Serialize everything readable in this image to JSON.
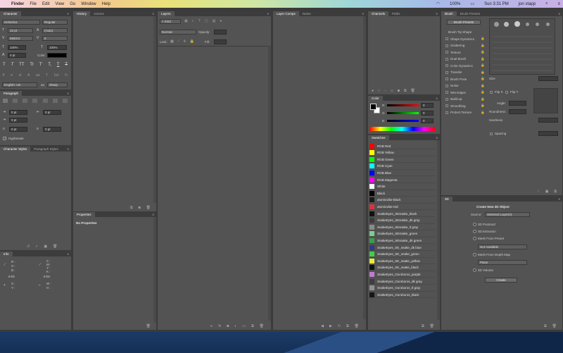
{
  "menubar": {
    "apple": "",
    "app": "Finder",
    "items": [
      "File",
      "Edit",
      "View",
      "Go",
      "Window",
      "Help"
    ],
    "battery": "100%",
    "clock": "Sun 3:31 PM",
    "user": "jon stapp"
  },
  "character": {
    "tab": "Character",
    "font_family": "Helvetica",
    "font_style": "Regular",
    "size": "12 pt",
    "leading": "(Auto)",
    "kerning": "Metrics",
    "tracking": "0",
    "vscale": "100%",
    "hscale": "100%",
    "baseline": "0 pt",
    "color_label": "Color:",
    "language": "English: UK",
    "aa": "Sharp",
    "aa_label": "aa"
  },
  "paragraph": {
    "tab": "Paragraph",
    "indent_left": "0 pt",
    "indent_right": "0 pt",
    "first_line": "0 pt",
    "space_before": "0 pt",
    "space_after": "0 pt",
    "hyphenate": "Hyphenate"
  },
  "styles": {
    "tabs": [
      "Character Styles",
      "Paragraph Styles"
    ]
  },
  "info": {
    "tab": "Info",
    "rgb": [
      "R :",
      "G :",
      "B :"
    ],
    "cmyk": [
      "C :",
      "M :",
      "Y :",
      "K :"
    ],
    "bit1": "8-bit",
    "bit2": "8-bit",
    "x": "X :",
    "y": "Y :",
    "w": "W :",
    "h": "H :"
  },
  "history": {
    "tabs": [
      "History",
      "Actions"
    ]
  },
  "properties": {
    "tab": "Properties",
    "empty": "No Properties"
  },
  "layers": {
    "tab": "Layers",
    "kind": "Kind",
    "blend": "Normal",
    "opacity_label": "Opacity:",
    "lock_label": "Lock:",
    "fill_label": "Fill:"
  },
  "layercomps": {
    "tabs": [
      "Layer Comps",
      "Notes"
    ]
  },
  "channels": {
    "tabs": [
      "Channels",
      "Paths"
    ]
  },
  "color": {
    "tab": "Color",
    "r": "R",
    "g": "G",
    "b": "B",
    "rv": "0",
    "gv": "0",
    "bv": "0"
  },
  "swatches": {
    "tab": "Swatches",
    "items": [
      {
        "name": "RGB Red",
        "color": "#ff0000"
      },
      {
        "name": "RGB Yellow",
        "color": "#ffff00"
      },
      {
        "name": "RGB Green",
        "color": "#00ff00"
      },
      {
        "name": "RGB Cyan",
        "color": "#00ffff"
      },
      {
        "name": "RGB Blue",
        "color": "#0000ff"
      },
      {
        "name": "RGB Magenta",
        "color": "#ff00ff"
      },
      {
        "name": "White",
        "color": "#ffffff"
      },
      {
        "name": "Black",
        "color": "#000000"
      },
      {
        "name": "atomicvibe-black",
        "color": "#1a1a1a"
      },
      {
        "name": "atomicvibe-red",
        "color": "#d8353b"
      },
      {
        "name": "SnakeEyes_SEsnake_black",
        "color": "#111111"
      },
      {
        "name": "SnakeEyes_SEsnake_dk gray",
        "color": "#3c3c3c"
      },
      {
        "name": "SnakeEyes_SEsnake_lt gray",
        "color": "#8a8a8a"
      },
      {
        "name": "SnakeEyes_SEsnake_green",
        "color": "#7ccf8b"
      },
      {
        "name": "SnakeEyes_SEsnake_dk green",
        "color": "#3b9e4d"
      },
      {
        "name": "SnakeEyes_SE_snake_dk blue",
        "color": "#2c3e7e"
      },
      {
        "name": "SnakeEyes_SE_snake_green",
        "color": "#3fd04a"
      },
      {
        "name": "SnakeEyes_SE_snake_yellow",
        "color": "#e9e93a"
      },
      {
        "name": "SnakeEyes_SE_snake_black",
        "color": "#101010"
      },
      {
        "name": "SnakeEyes_Ouroboros_purple",
        "color": "#c07cd0"
      },
      {
        "name": "SnakeEyes_Ouroboros_dk gray",
        "color": "#3e3e3e"
      },
      {
        "name": "SnakeEyes_Ouroboros_lt gray",
        "color": "#909090"
      },
      {
        "name": "SnakeEyes_Ouroboros_black",
        "color": "#161616"
      }
    ]
  },
  "brush": {
    "tabs": [
      "Brush",
      "Brush Presets"
    ],
    "presets_btn": "Brush Presets",
    "items": [
      "Brush Tip Shape",
      "Shape Dynamics",
      "Scattering",
      "Texture",
      "Dual Brush",
      "Color Dynamics",
      "Transfer",
      "Brush Pose",
      "Noise",
      "Wet Edges",
      "Build-up",
      "Smoothing",
      "Protect Texture"
    ],
    "size": "Size",
    "flipx": "Flip X",
    "flipy": "Flip Y",
    "angle": "Angle:",
    "roundness": "Roundness:",
    "hardness": "Hardness",
    "spacing": "Spacing"
  },
  "threed": {
    "tab": "3D",
    "title": "Create New 3D Object",
    "source_label": "Source:",
    "source": "Selected Layer(s)",
    "options": [
      "3D Postcard",
      "3D Extrusion",
      "Mesh From Preset",
      "Mesh From Depth Map",
      "3D Volume"
    ],
    "preset": "Not Available",
    "depth": "Plane",
    "create": "Create"
  }
}
